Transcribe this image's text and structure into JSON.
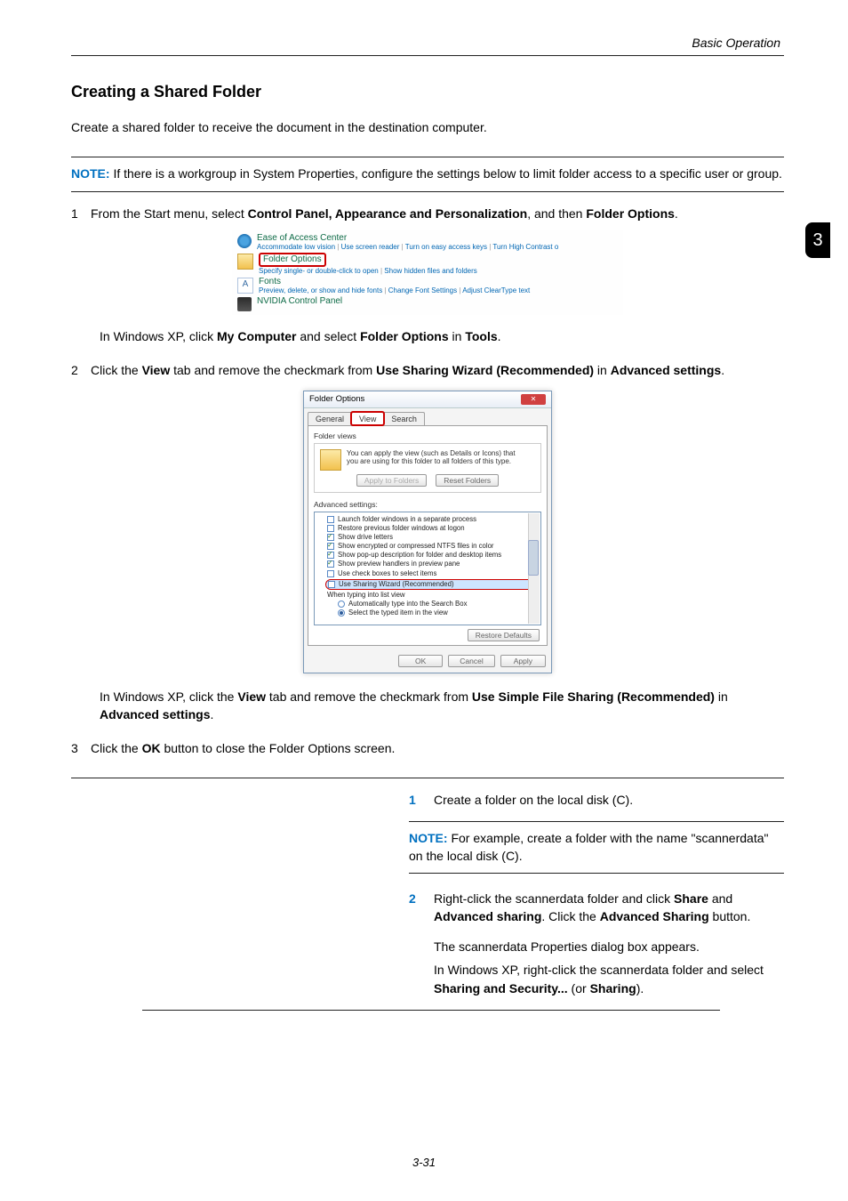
{
  "header": {
    "right": "Basic Operation"
  },
  "side_tab": "3",
  "page_number": "3-31",
  "title": "Creating a Shared Folder",
  "intro": "Create a shared folder to receive the document in the destination computer.",
  "note1": {
    "label": "NOTE:",
    "text": " If there is a workgroup in System Properties, configure the settings below to limit folder access to a specific user or group."
  },
  "step1": {
    "num": "1",
    "pre": "From the Start menu, select ",
    "b1": "Control Panel, Appearance and Personalization",
    "mid": ", and then ",
    "b2": "Folder Options",
    "post": "."
  },
  "cp_img": {
    "ease": {
      "title": "Ease of Access Center",
      "l1": "Accommodate low vision",
      "l2": "Use screen reader",
      "l3": "Turn on easy access keys",
      "l4": "Turn High Contrast o"
    },
    "folder": {
      "title": "Folder Options",
      "l1": "Specify single- or double-click to open",
      "l2": "Show hidden files and folders"
    },
    "fonts": {
      "title": "Fonts",
      "l1": "Preview, delete, or show and hide fonts",
      "l2": "Change Font Settings",
      "l3": "Adjust ClearType text"
    },
    "nvidia": {
      "title": "NVIDIA Control Panel"
    }
  },
  "sub1": {
    "pre": "In Windows XP, click ",
    "b1": "My Computer",
    "mid": " and select ",
    "b2": "Folder Options",
    "mid2": " in ",
    "b3": "Tools",
    "post": "."
  },
  "step2": {
    "num": "2",
    "pre": "Click the ",
    "b1": "View",
    "mid": " tab and remove the checkmark from ",
    "b2": "Use Sharing Wizard (Recommended)",
    "mid2": " in ",
    "b3": "Advanced settings",
    "post": "."
  },
  "fo_dialog": {
    "title": "Folder Options",
    "tabs": {
      "general": "General",
      "view": "View",
      "search": "Search"
    },
    "fv_label": "Folder views",
    "fv_text1": "You can apply the view (such as Details or Icons) that",
    "fv_text2": "you are using for this folder to all folders of this type.",
    "apply_folders": "Apply to Folders",
    "reset_folders": "Reset Folders",
    "adv_label": "Advanced settings:",
    "rows": {
      "r1": "Launch folder windows in a separate process",
      "r2": "Restore previous folder windows at logon",
      "r3": "Show drive letters",
      "r4": "Show encrypted or compressed NTFS files in color",
      "r5": "Show pop-up description for folder and desktop items",
      "r6": "Show preview handlers in preview pane",
      "r7": "Use check boxes to select items",
      "r8": "Use Sharing Wizard (Recommended)",
      "r9": "When typing into list view",
      "r10": "Automatically type into the Search Box",
      "r11": "Select the typed item in the view"
    },
    "restore_defaults": "Restore Defaults",
    "ok": "OK",
    "cancel": "Cancel",
    "apply": "Apply"
  },
  "sub2": {
    "pre": "In Windows XP, click the ",
    "b1": "View",
    "mid": " tab and remove the checkmark from ",
    "b2": "Use Simple File Sharing (Recommended)",
    "mid2": " in ",
    "b3": "Advanced settings",
    "post": "."
  },
  "step3": {
    "num": "3",
    "pre": "Click the ",
    "b1": "OK",
    "post": " button to close the Folder Options screen."
  },
  "right": {
    "r1": {
      "num": "1",
      "text": "Create a folder on the local disk (C)."
    },
    "note": {
      "label": "NOTE:",
      "text": " For example, create a folder with the name \"scannerdata\" on the local disk (C)."
    },
    "r2": {
      "num": "2",
      "pre": "Right-click the scannerdata folder and click ",
      "b1": "Share",
      "mid": " and ",
      "b2": "Advanced sharing",
      "mid2": ". Click the ",
      "b3": "Advanced Sharing",
      "post": " button."
    },
    "r2b": "The scannerdata Properties dialog box appears.",
    "r2c_pre": "In Windows XP, right-click the scannerdata folder and select ",
    "r2c_b": "Sharing and Security...",
    "r2c_mid": " (or ",
    "r2c_b2": "Sharing",
    "r2c_post": ")."
  }
}
